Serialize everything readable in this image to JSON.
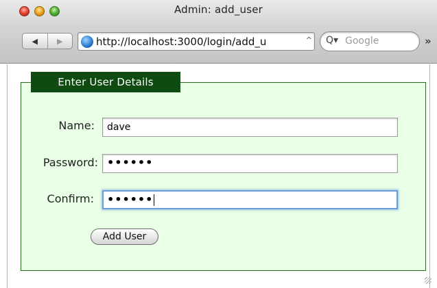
{
  "window": {
    "title": "Admin: add_user"
  },
  "toolbar": {
    "back_label": "◀",
    "forward_label": "▶",
    "url": "http://localhost:3000/login/add_u",
    "url_menu_arrow": "^",
    "search_icon": "Q▾",
    "search_placeholder": "Google",
    "overflow_label": "»"
  },
  "form": {
    "legend": "Enter User Details",
    "name_label": "Name:",
    "name_value": "dave",
    "password_label": "Password:",
    "password_value": "••••••",
    "confirm_label": "Confirm:",
    "confirm_value": "••••••",
    "submit_label": "Add User"
  },
  "colors": {
    "fieldset_bg": "#e9ffe6",
    "legend_bg": "#0f4a11",
    "focus_ring": "#6c9ed6"
  }
}
